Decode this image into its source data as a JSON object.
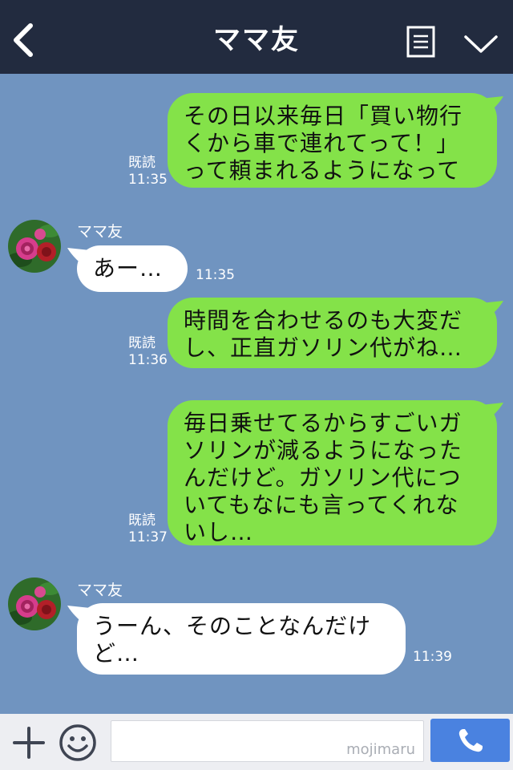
{
  "header": {
    "title": "ママ友"
  },
  "messages": [
    {
      "direction": "out",
      "text": "その日以来毎日「買い物行\nくから車で連れてって！」\nって頼まれるようになって",
      "read": "既読",
      "time": "11:35"
    },
    {
      "direction": "in",
      "sender": "ママ友",
      "text": "あー…",
      "time": "11:35"
    },
    {
      "direction": "out",
      "text": "時間を合わせるのも大変だ\nし、正直ガソリン代がね…",
      "read": "既読",
      "time": "11:36"
    },
    {
      "direction": "out",
      "text": "毎日乗せてるからすごいガ\nソリンが減るようになった\nんだけど。ガソリン代につ\nいてもなにも言ってくれな\nいし…",
      "read": "既読",
      "time": "11:37"
    },
    {
      "direction": "in",
      "sender": "ママ友",
      "text": "うーん、そのことなんだけ\nど…",
      "time": "11:39"
    }
  ],
  "input": {
    "watermark": "mojimaru"
  },
  "colors": {
    "background": "#7094c0",
    "header": "#222b3f",
    "outgoing_bubble": "#84e249",
    "incoming_bubble": "#ffffff",
    "call_button": "#4a82e0"
  },
  "icons": [
    "back-icon",
    "menu-icon",
    "chevron-down-icon",
    "plus-icon",
    "smile-icon",
    "phone-icon"
  ]
}
